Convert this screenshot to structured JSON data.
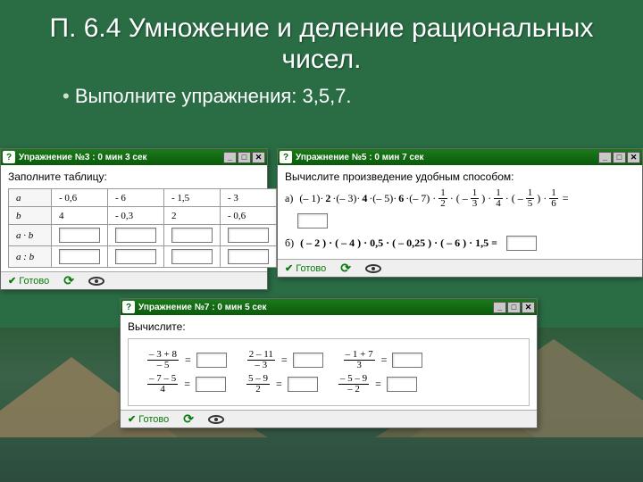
{
  "slide": {
    "title": "П. 6.4 Умножение и деление рациональных чисел.",
    "subtitle": "Выполните упражнения: 3,5,7."
  },
  "common": {
    "ready": "Готово",
    "minimize": "_",
    "maximize": "□",
    "close": "✕",
    "help": "?"
  },
  "p3": {
    "title": "Упражнение №3 : 0 мин  3 сек",
    "instr": "Заполните таблицу:",
    "rows": {
      "r1": "a",
      "r2": "b",
      "r3": "a · b",
      "r4": "a : b"
    },
    "a": [
      "- 0,6",
      "- 6",
      "- 1,5",
      "- 3"
    ],
    "b": [
      "4",
      "- 0,3",
      "2",
      "- 0,6"
    ]
  },
  "p5": {
    "title": "Упражнение №5 : 0 мин  7 сек",
    "instr": "Вычислите произведение удобным способом:",
    "labelA": "а)",
    "labelB": "б)",
    "partA": {
      "t1": "(– 1)·",
      "t2": "2",
      "t3": "·(– 3)·",
      "t4": "4",
      "t5": "·(– 5)·",
      "t6": "6",
      "t7": "·(– 7) ·",
      "eqend": "="
    },
    "fracs": [
      {
        "n": "1",
        "d": "2"
      },
      {
        "n": "1",
        "d": "3"
      },
      {
        "n": "1",
        "d": "4"
      },
      {
        "n": "1",
        "d": "5"
      },
      {
        "n": "1",
        "d": "6"
      }
    ],
    "partB": "( – 2 ) · ( – 4 ) · 0,5 · ( – 0,25 ) · ( – 6 ) · 1,5 ="
  },
  "p7": {
    "title": "Упражнение №7 : 0 мин  5 сек",
    "instr": "Вычислите:",
    "items": [
      {
        "n": "– 3 + 8",
        "d": "– 5"
      },
      {
        "n": "2 – 11",
        "d": "– 3"
      },
      {
        "n": "– 1 + 7",
        "d": "3"
      },
      {
        "n": "– 7 – 5",
        "d": "4"
      },
      {
        "n": "5 – 9",
        "d": "2"
      },
      {
        "n": "– 5 – 9",
        "d": "– 2"
      }
    ]
  }
}
